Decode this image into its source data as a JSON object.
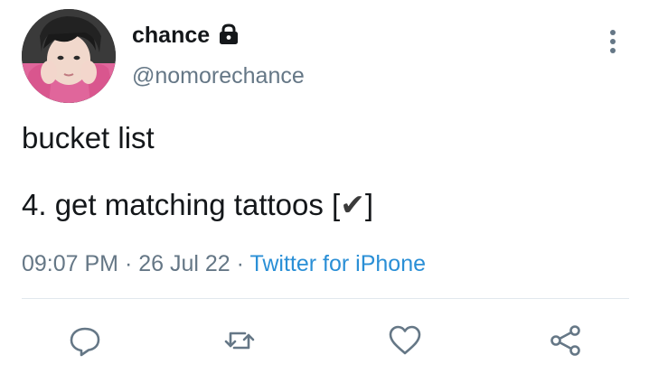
{
  "user": {
    "display_name": "chance",
    "handle": "@nomorechance",
    "avatar_icon": "profile-photo",
    "protected_icon": "lock-icon"
  },
  "tweet": {
    "line1": "bucket list",
    "line2_text": "4. get matching tattoos [",
    "line2_check": "✔",
    "line2_end": "]",
    "time": "09:07 PM",
    "sep1": " · ",
    "date": "26 Jul 22",
    "sep2": " · ",
    "source": "Twitter for iPhone"
  },
  "actions": {
    "reply_icon": "reply-icon",
    "retweet_icon": "retweet-icon",
    "like_icon": "heart-icon",
    "share_icon": "share-icon",
    "more_icon": "more-vertical-icon"
  },
  "colors": {
    "text": "#14171a",
    "secondary": "#657786",
    "link": "#2a8fd6",
    "divider": "#e1e8ed",
    "icon": "#657786"
  }
}
